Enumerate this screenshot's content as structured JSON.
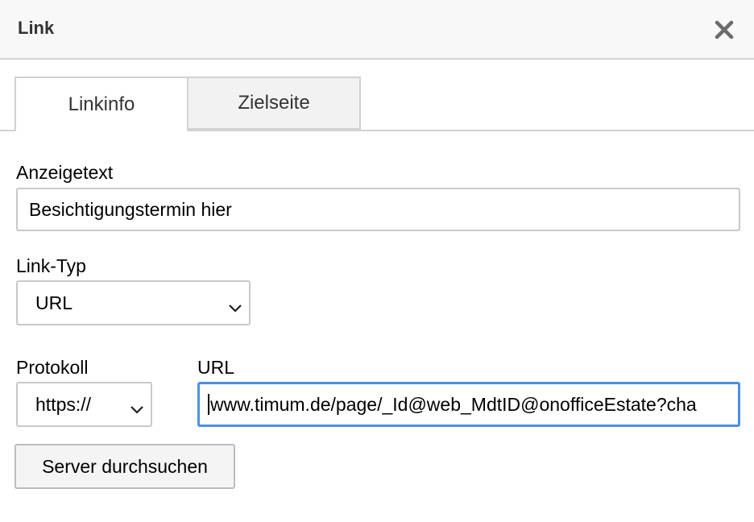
{
  "dialog": {
    "title": "Link",
    "close_icon": "close-icon"
  },
  "tabs": [
    {
      "label": "Linkinfo",
      "active": true
    },
    {
      "label": "Zielseite",
      "active": false
    }
  ],
  "fields": {
    "display_text": {
      "label": "Anzeigetext",
      "value": "Besichtigungstermin hier"
    },
    "link_type": {
      "label": "Link-Typ",
      "selected": "URL"
    },
    "protocol": {
      "label": "Protokoll",
      "selected": "https://"
    },
    "url": {
      "label": "URL",
      "value": "www.timum.de/page/_Id@web_MdtID@onofficeEstate?cha"
    }
  },
  "buttons": {
    "browse_server": "Server durchsuchen"
  },
  "colors": {
    "focus_border": "#4a90e2",
    "titlebar_bg": "#f8f8f8",
    "border": "#d1d1d1"
  }
}
